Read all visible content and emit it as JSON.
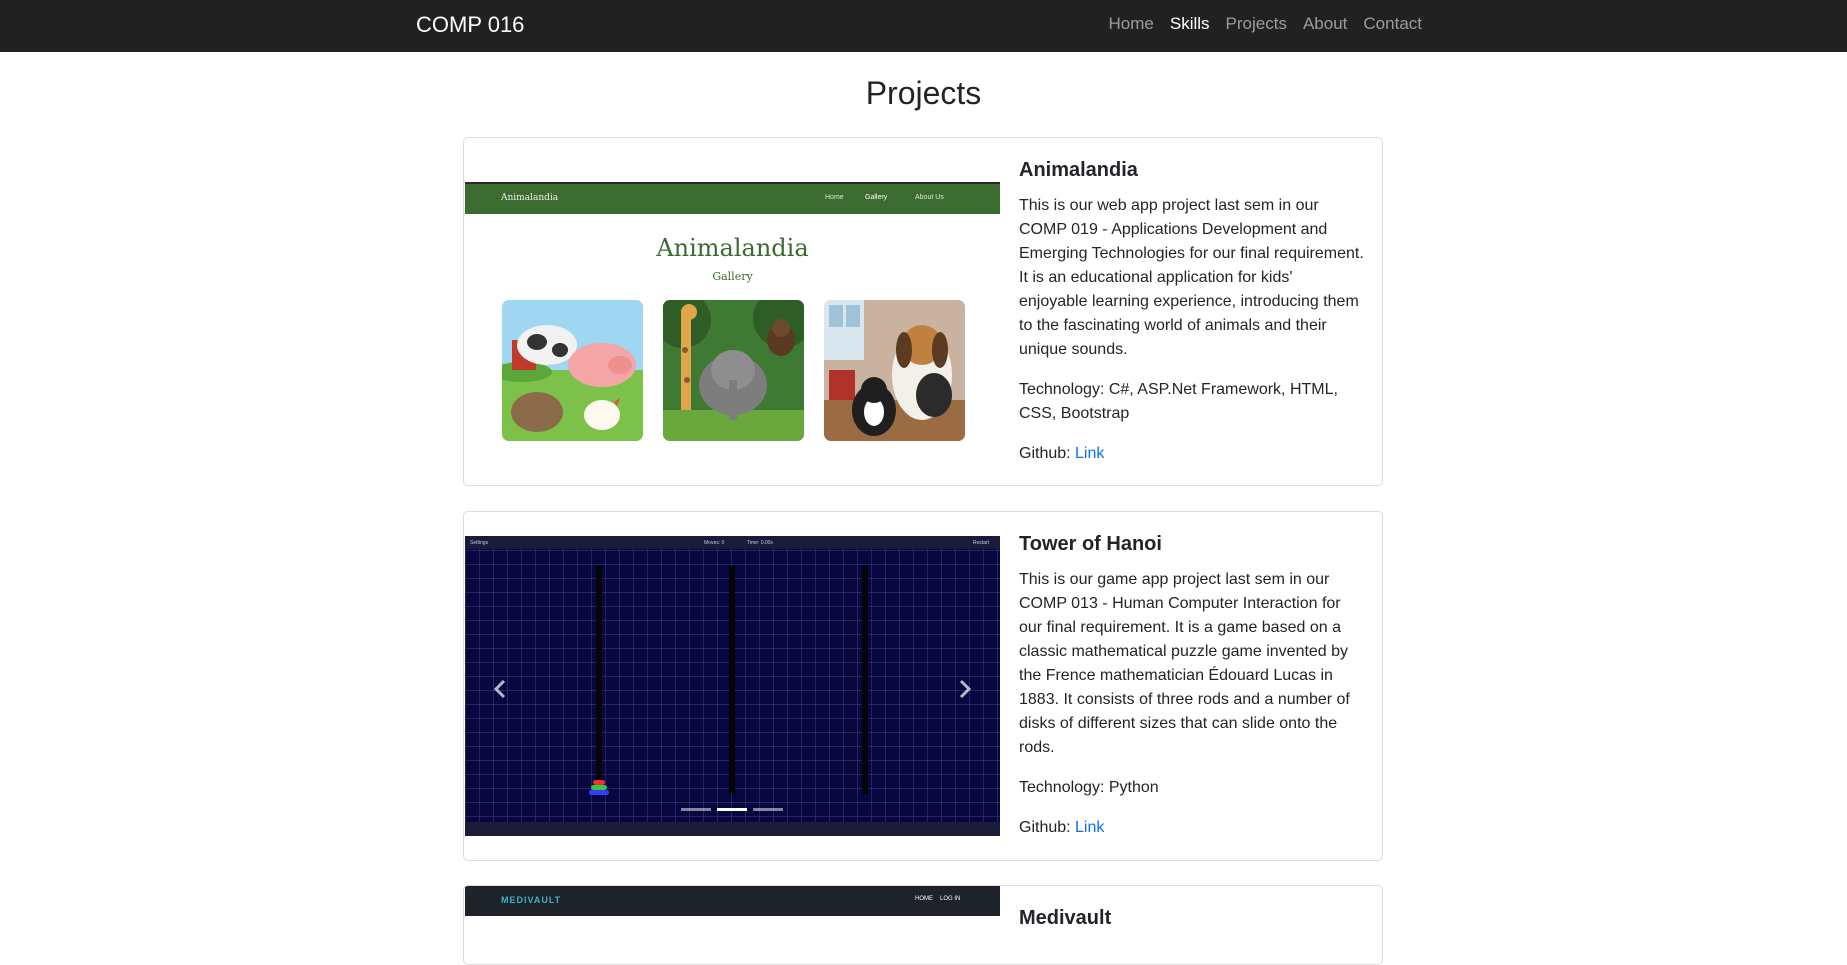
{
  "navbar": {
    "brand": "COMP 016",
    "links": [
      {
        "label": "Home",
        "active": false
      },
      {
        "label": "Skills",
        "active": true
      },
      {
        "label": "Projects",
        "active": false
      },
      {
        "label": "About",
        "active": false
      },
      {
        "label": "Contact",
        "active": false
      }
    ]
  },
  "page": {
    "title": "Projects"
  },
  "projects": [
    {
      "title": "Animalandia",
      "description": "This is our web app project last sem in our COMP 019 - Applications Development and Emerging Technologies for our final requirement. It is an educational application for kids' enjoyable learning experience, introducing them to the fascinating world of animals and their unique sounds.",
      "technology": "Technology: C#, ASP.Net Framework, HTML, CSS, Bootstrap",
      "github_label": "Github: ",
      "github_link": "Link",
      "screenshot": {
        "brand": "Animalandia",
        "nav": [
          "Home",
          "Gallery",
          "About Us"
        ],
        "heading": "Animalandia",
        "subheading": "Gallery"
      }
    },
    {
      "title": "Tower of Hanoi",
      "description": "This is our game app project last sem in our COMP 013 - Human Computer Interaction for our final requirement. It is a game based on a classic mathematical puzzle game invented by the Frence mathematician Édouard Lucas in 1883. It consists of three rods and a number of disks of different sizes that can slide onto the rods.",
      "technology": "Technology: Python",
      "github_label": "Github: ",
      "github_link": "Link",
      "screenshot": {
        "top_left": "Settings",
        "moves": "Moves: 0",
        "time": "Time: 0.00s",
        "top_right": "Restart"
      }
    },
    {
      "title": "Medivault",
      "screenshot": {
        "brand": "MEDIVAULT",
        "nav": [
          "HOME",
          "LOG IN"
        ]
      }
    }
  ],
  "colors": {
    "navbar_bg": "#212121",
    "link": "#0d6efd",
    "anim_green": "#3b6b2f",
    "hanoi_bg": "#07063e",
    "medi_teal": "#3fb3c9"
  },
  "icons": {
    "carousel_prev": "chevron-left-icon",
    "carousel_next": "chevron-right-icon"
  }
}
